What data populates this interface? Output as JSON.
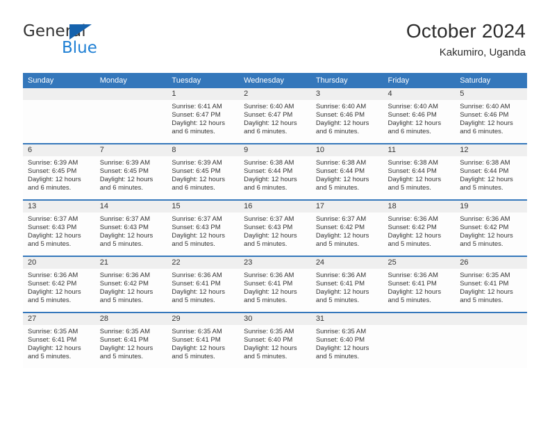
{
  "brand": {
    "name_line1": "General",
    "name_line2": "Blue",
    "color_dark": "#333333",
    "color_blue": "#1e7fd4",
    "triangle_color": "#1562ad"
  },
  "header": {
    "title": "October 2024",
    "location": "Kakumiro, Uganda"
  },
  "theme": {
    "header_blue": "#3477bb",
    "daynum_strip": "#efefef",
    "cell_background": "#fdfdfd",
    "text": "#333333"
  },
  "weekday_headers": [
    "Sunday",
    "Monday",
    "Tuesday",
    "Wednesday",
    "Thursday",
    "Friday",
    "Saturday"
  ],
  "labels": {
    "sunrise_prefix": "Sunrise: ",
    "sunset_prefix": "Sunset: ",
    "daylight_prefix": "Daylight: "
  },
  "weeks": [
    [
      {
        "day": "",
        "empty": true
      },
      {
        "day": "",
        "empty": true
      },
      {
        "day": "1",
        "sunrise": "Sunrise: 6:41 AM",
        "sunset": "Sunset: 6:47 PM",
        "daylight": "Daylight: 12 hours and 6 minutes."
      },
      {
        "day": "2",
        "sunrise": "Sunrise: 6:40 AM",
        "sunset": "Sunset: 6:47 PM",
        "daylight": "Daylight: 12 hours and 6 minutes."
      },
      {
        "day": "3",
        "sunrise": "Sunrise: 6:40 AM",
        "sunset": "Sunset: 6:46 PM",
        "daylight": "Daylight: 12 hours and 6 minutes."
      },
      {
        "day": "4",
        "sunrise": "Sunrise: 6:40 AM",
        "sunset": "Sunset: 6:46 PM",
        "daylight": "Daylight: 12 hours and 6 minutes."
      },
      {
        "day": "5",
        "sunrise": "Sunrise: 6:40 AM",
        "sunset": "Sunset: 6:46 PM",
        "daylight": "Daylight: 12 hours and 6 minutes."
      }
    ],
    [
      {
        "day": "6",
        "sunrise": "Sunrise: 6:39 AM",
        "sunset": "Sunset: 6:45 PM",
        "daylight": "Daylight: 12 hours and 6 minutes."
      },
      {
        "day": "7",
        "sunrise": "Sunrise: 6:39 AM",
        "sunset": "Sunset: 6:45 PM",
        "daylight": "Daylight: 12 hours and 6 minutes."
      },
      {
        "day": "8",
        "sunrise": "Sunrise: 6:39 AM",
        "sunset": "Sunset: 6:45 PM",
        "daylight": "Daylight: 12 hours and 6 minutes."
      },
      {
        "day": "9",
        "sunrise": "Sunrise: 6:38 AM",
        "sunset": "Sunset: 6:44 PM",
        "daylight": "Daylight: 12 hours and 6 minutes."
      },
      {
        "day": "10",
        "sunrise": "Sunrise: 6:38 AM",
        "sunset": "Sunset: 6:44 PM",
        "daylight": "Daylight: 12 hours and 5 minutes."
      },
      {
        "day": "11",
        "sunrise": "Sunrise: 6:38 AM",
        "sunset": "Sunset: 6:44 PM",
        "daylight": "Daylight: 12 hours and 5 minutes."
      },
      {
        "day": "12",
        "sunrise": "Sunrise: 6:38 AM",
        "sunset": "Sunset: 6:44 PM",
        "daylight": "Daylight: 12 hours and 5 minutes."
      }
    ],
    [
      {
        "day": "13",
        "sunrise": "Sunrise: 6:37 AM",
        "sunset": "Sunset: 6:43 PM",
        "daylight": "Daylight: 12 hours and 5 minutes."
      },
      {
        "day": "14",
        "sunrise": "Sunrise: 6:37 AM",
        "sunset": "Sunset: 6:43 PM",
        "daylight": "Daylight: 12 hours and 5 minutes."
      },
      {
        "day": "15",
        "sunrise": "Sunrise: 6:37 AM",
        "sunset": "Sunset: 6:43 PM",
        "daylight": "Daylight: 12 hours and 5 minutes."
      },
      {
        "day": "16",
        "sunrise": "Sunrise: 6:37 AM",
        "sunset": "Sunset: 6:43 PM",
        "daylight": "Daylight: 12 hours and 5 minutes."
      },
      {
        "day": "17",
        "sunrise": "Sunrise: 6:37 AM",
        "sunset": "Sunset: 6:42 PM",
        "daylight": "Daylight: 12 hours and 5 minutes."
      },
      {
        "day": "18",
        "sunrise": "Sunrise: 6:36 AM",
        "sunset": "Sunset: 6:42 PM",
        "daylight": "Daylight: 12 hours and 5 minutes."
      },
      {
        "day": "19",
        "sunrise": "Sunrise: 6:36 AM",
        "sunset": "Sunset: 6:42 PM",
        "daylight": "Daylight: 12 hours and 5 minutes."
      }
    ],
    [
      {
        "day": "20",
        "sunrise": "Sunrise: 6:36 AM",
        "sunset": "Sunset: 6:42 PM",
        "daylight": "Daylight: 12 hours and 5 minutes."
      },
      {
        "day": "21",
        "sunrise": "Sunrise: 6:36 AM",
        "sunset": "Sunset: 6:42 PM",
        "daylight": "Daylight: 12 hours and 5 minutes."
      },
      {
        "day": "22",
        "sunrise": "Sunrise: 6:36 AM",
        "sunset": "Sunset: 6:41 PM",
        "daylight": "Daylight: 12 hours and 5 minutes."
      },
      {
        "day": "23",
        "sunrise": "Sunrise: 6:36 AM",
        "sunset": "Sunset: 6:41 PM",
        "daylight": "Daylight: 12 hours and 5 minutes."
      },
      {
        "day": "24",
        "sunrise": "Sunrise: 6:36 AM",
        "sunset": "Sunset: 6:41 PM",
        "daylight": "Daylight: 12 hours and 5 minutes."
      },
      {
        "day": "25",
        "sunrise": "Sunrise: 6:36 AM",
        "sunset": "Sunset: 6:41 PM",
        "daylight": "Daylight: 12 hours and 5 minutes."
      },
      {
        "day": "26",
        "sunrise": "Sunrise: 6:35 AM",
        "sunset": "Sunset: 6:41 PM",
        "daylight": "Daylight: 12 hours and 5 minutes."
      }
    ],
    [
      {
        "day": "27",
        "sunrise": "Sunrise: 6:35 AM",
        "sunset": "Sunset: 6:41 PM",
        "daylight": "Daylight: 12 hours and 5 minutes."
      },
      {
        "day": "28",
        "sunrise": "Sunrise: 6:35 AM",
        "sunset": "Sunset: 6:41 PM",
        "daylight": "Daylight: 12 hours and 5 minutes."
      },
      {
        "day": "29",
        "sunrise": "Sunrise: 6:35 AM",
        "sunset": "Sunset: 6:41 PM",
        "daylight": "Daylight: 12 hours and 5 minutes."
      },
      {
        "day": "30",
        "sunrise": "Sunrise: 6:35 AM",
        "sunset": "Sunset: 6:40 PM",
        "daylight": "Daylight: 12 hours and 5 minutes."
      },
      {
        "day": "31",
        "sunrise": "Sunrise: 6:35 AM",
        "sunset": "Sunset: 6:40 PM",
        "daylight": "Daylight: 12 hours and 5 minutes."
      },
      {
        "day": "",
        "empty": true
      },
      {
        "day": "",
        "empty": true
      }
    ]
  ]
}
